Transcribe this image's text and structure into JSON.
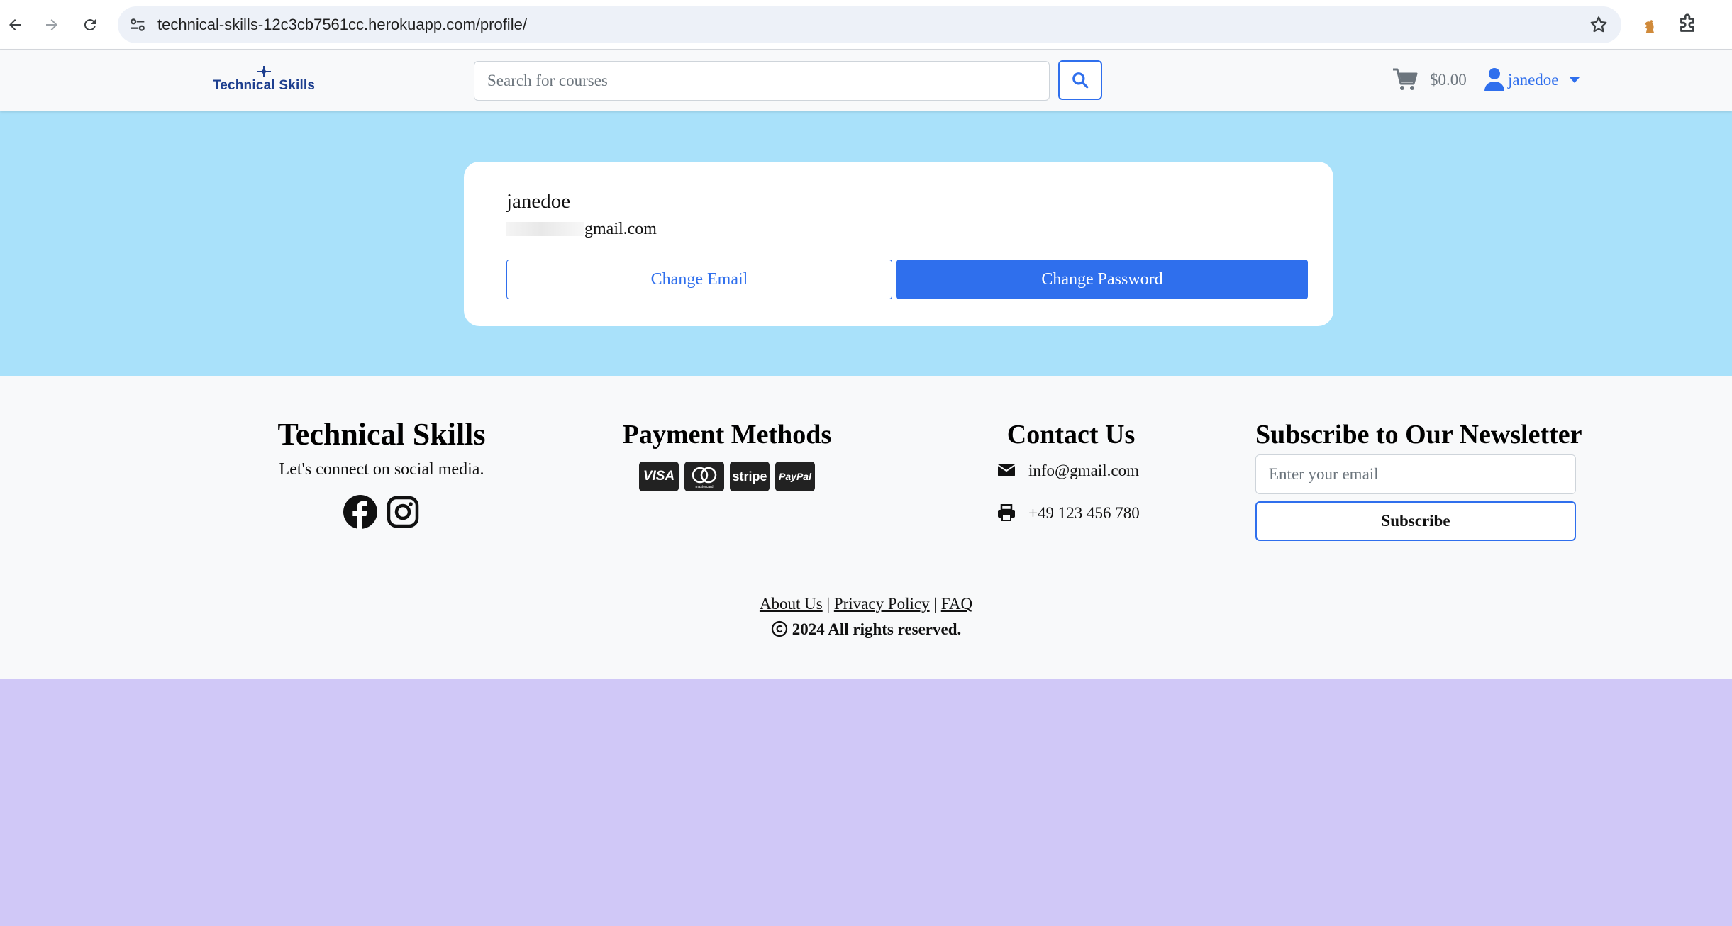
{
  "browser": {
    "url": "technical-skills-12c3cb7561cc.herokuapp.com/profile/"
  },
  "navbar": {
    "brand": "Technical Skills",
    "search_placeholder": "Search for courses",
    "cart_total": "$0.00",
    "username": "janedoe"
  },
  "profile": {
    "username": "janedoe",
    "email": "gmail.com",
    "change_email_label": "Change Email",
    "change_password_label": "Change Password"
  },
  "footer": {
    "brand_title": "Technical Skills",
    "tagline": "Let's connect on social media.",
    "payment_title": "Payment Methods",
    "payment_methods": [
      "VISA",
      "mastercard",
      "stripe",
      "PayPal"
    ],
    "contact_title": "Contact Us",
    "contact_email": "info@gmail.com",
    "contact_phone": "+49 123 456 780",
    "newsletter_title": "Subscribe to Our Newsletter",
    "newsletter_placeholder": "Enter your email",
    "subscribe_label": "Subscribe",
    "links": [
      "About Us",
      "Privacy Policy",
      "FAQ"
    ],
    "copyright": "2024 All rights reserved."
  },
  "colors": {
    "hero_bg": "#a9e1fa",
    "page_bg": "#d0c8f7",
    "primary": "#2f6fed",
    "footer_bg": "#f8f9fa"
  }
}
